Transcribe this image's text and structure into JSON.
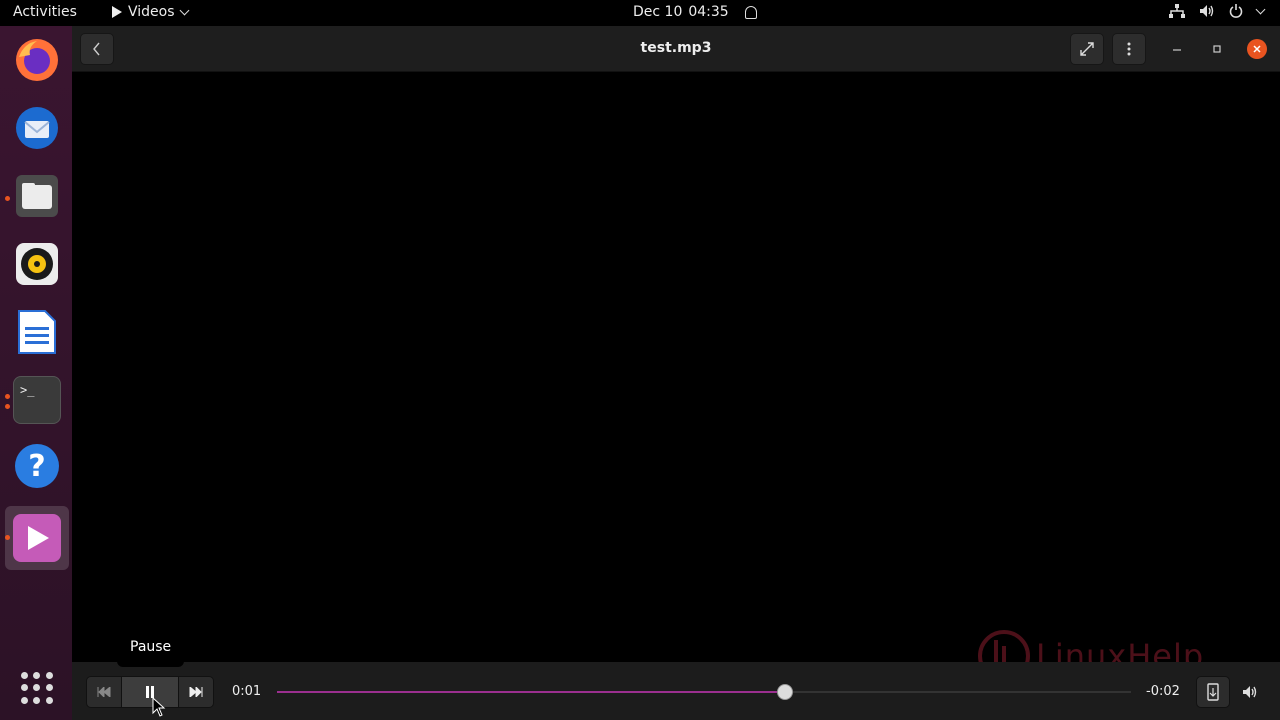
{
  "topbar": {
    "activities": "Activities",
    "app_menu": "Videos",
    "date": "Dec 10",
    "time": "04:35"
  },
  "dock": {
    "items": [
      {
        "name": "firefox",
        "icon": "firefox-icon"
      },
      {
        "name": "thunderbird",
        "icon": "thunderbird-icon"
      },
      {
        "name": "files",
        "icon": "files-icon"
      },
      {
        "name": "rhythmbox",
        "icon": "rhythmbox-icon"
      },
      {
        "name": "libreoffice-writer",
        "icon": "writer-icon"
      },
      {
        "name": "terminal",
        "icon": "terminal-icon",
        "label": ">_"
      },
      {
        "name": "help",
        "icon": "help-icon",
        "label": "?"
      },
      {
        "name": "videos",
        "icon": "videos-icon"
      }
    ]
  },
  "header": {
    "title": "test.mp3"
  },
  "controls": {
    "elapsed": "0:01",
    "remaining": "-0:02",
    "progress": 0.595,
    "tooltip": "Pause"
  },
  "watermark": {
    "text": "LinuxHelp"
  },
  "colors": {
    "accent": "#e95420",
    "progress": "#9b2f8f",
    "dock_bg": "#3a1530"
  }
}
